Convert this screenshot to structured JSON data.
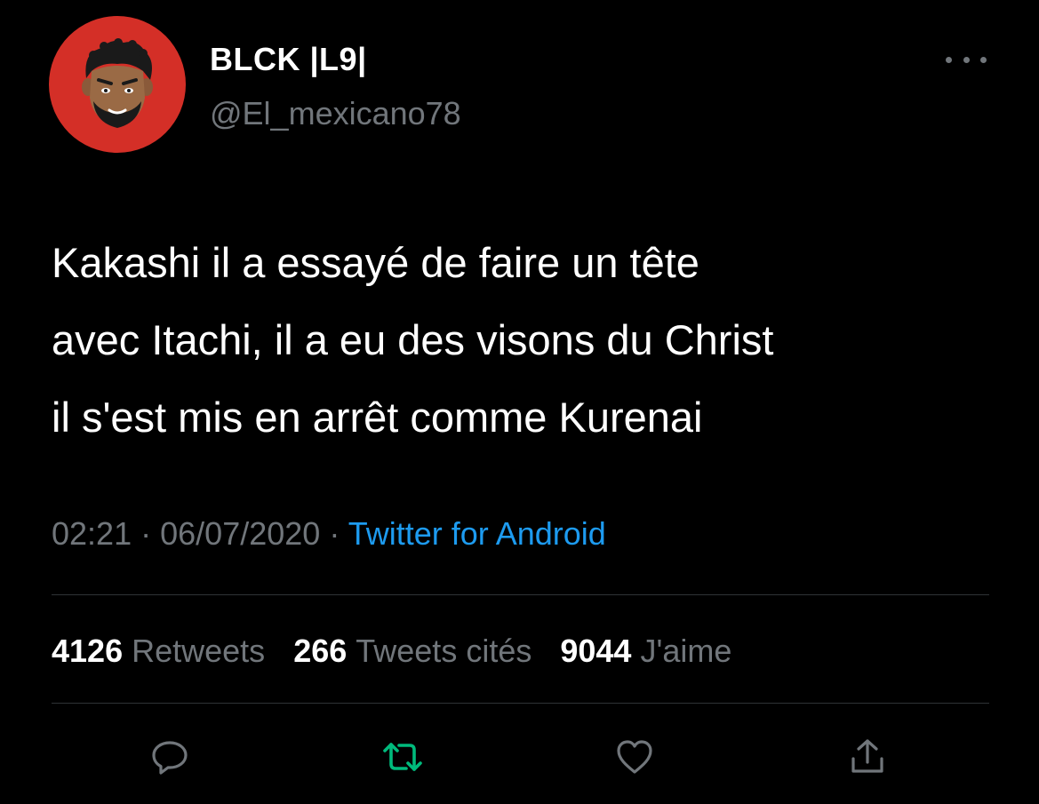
{
  "author": {
    "display_name": "BLCK |L9|",
    "handle": "@El_mexicano78",
    "avatar_icon": "cartoon-face-avatar",
    "avatar_color": "#d42f27"
  },
  "tweet": {
    "lines": [
      "Kakashi il a essayé de faire un tête",
      "avec Itachi, il a eu des visons du Christ",
      "il s'est mis en arrêt comme Kurenai"
    ],
    "time": "02:21",
    "separator": "·",
    "date": "06/07/2020",
    "source": "Twitter for Android"
  },
  "stats": [
    {
      "count": "4126",
      "label": "Retweets"
    },
    {
      "count": "266",
      "label": "Tweets cités"
    },
    {
      "count": "9044",
      "label": "J'aime"
    }
  ],
  "actions": {
    "reply": "reply-icon",
    "retweet": "retweet-icon",
    "like": "heart-icon",
    "share": "share-icon"
  },
  "colors": {
    "background": "#000000",
    "text": "#ffffff",
    "muted": "#71767b",
    "link": "#1d9bf0",
    "retweet": "#00ba7c",
    "divider": "#2f3336"
  }
}
